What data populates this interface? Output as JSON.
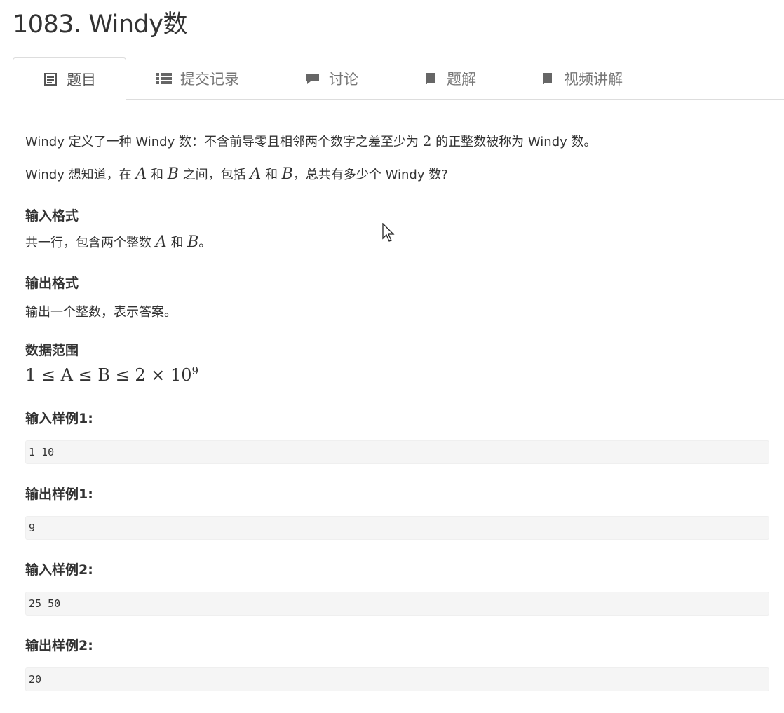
{
  "title": "1083. Windy数",
  "tabs": [
    {
      "label": "题目",
      "icon": "document-icon"
    },
    {
      "label": "提交记录",
      "icon": "list-icon"
    },
    {
      "label": "讨论",
      "icon": "comment-icon"
    },
    {
      "label": "题解",
      "icon": "book-icon"
    },
    {
      "label": "视频讲解",
      "icon": "book-icon"
    }
  ],
  "description": {
    "p1_a": "Windy 定义了一种 Windy 数：不含前导零且相邻两个数字之差至少为",
    "p1_num": "2",
    "p1_b": "的正整数被称为 Windy 数。",
    "p2_a": "Windy 想知道，在",
    "var_a": "A",
    "p2_and1": "和",
    "var_b": "B",
    "p2_b": "之间，包括",
    "p2_and2": "和",
    "p2_c": "，总共有多少个 Windy 数?"
  },
  "input_format": {
    "heading": "输入格式",
    "text_a": "共一行，包含两个整数",
    "text_and": "和",
    "text_end": "。"
  },
  "output_format": {
    "heading": "输出格式",
    "text": "输出一个整数，表示答案。"
  },
  "range": {
    "heading": "数据范围",
    "formula": "1 ≤ A ≤ B ≤ 2 × 10",
    "exponent": "9"
  },
  "samples": [
    {
      "heading": "输入样例1:",
      "value": "1 10"
    },
    {
      "heading": "输出样例1:",
      "value": "9"
    },
    {
      "heading": "输入样例2:",
      "value": "25 50"
    },
    {
      "heading": "输出样例2:",
      "value": "20"
    }
  ],
  "colors": {
    "text": "#333333",
    "tab_text": "#777777",
    "code_bg": "#f5f5f5",
    "border": "#dddddd"
  }
}
